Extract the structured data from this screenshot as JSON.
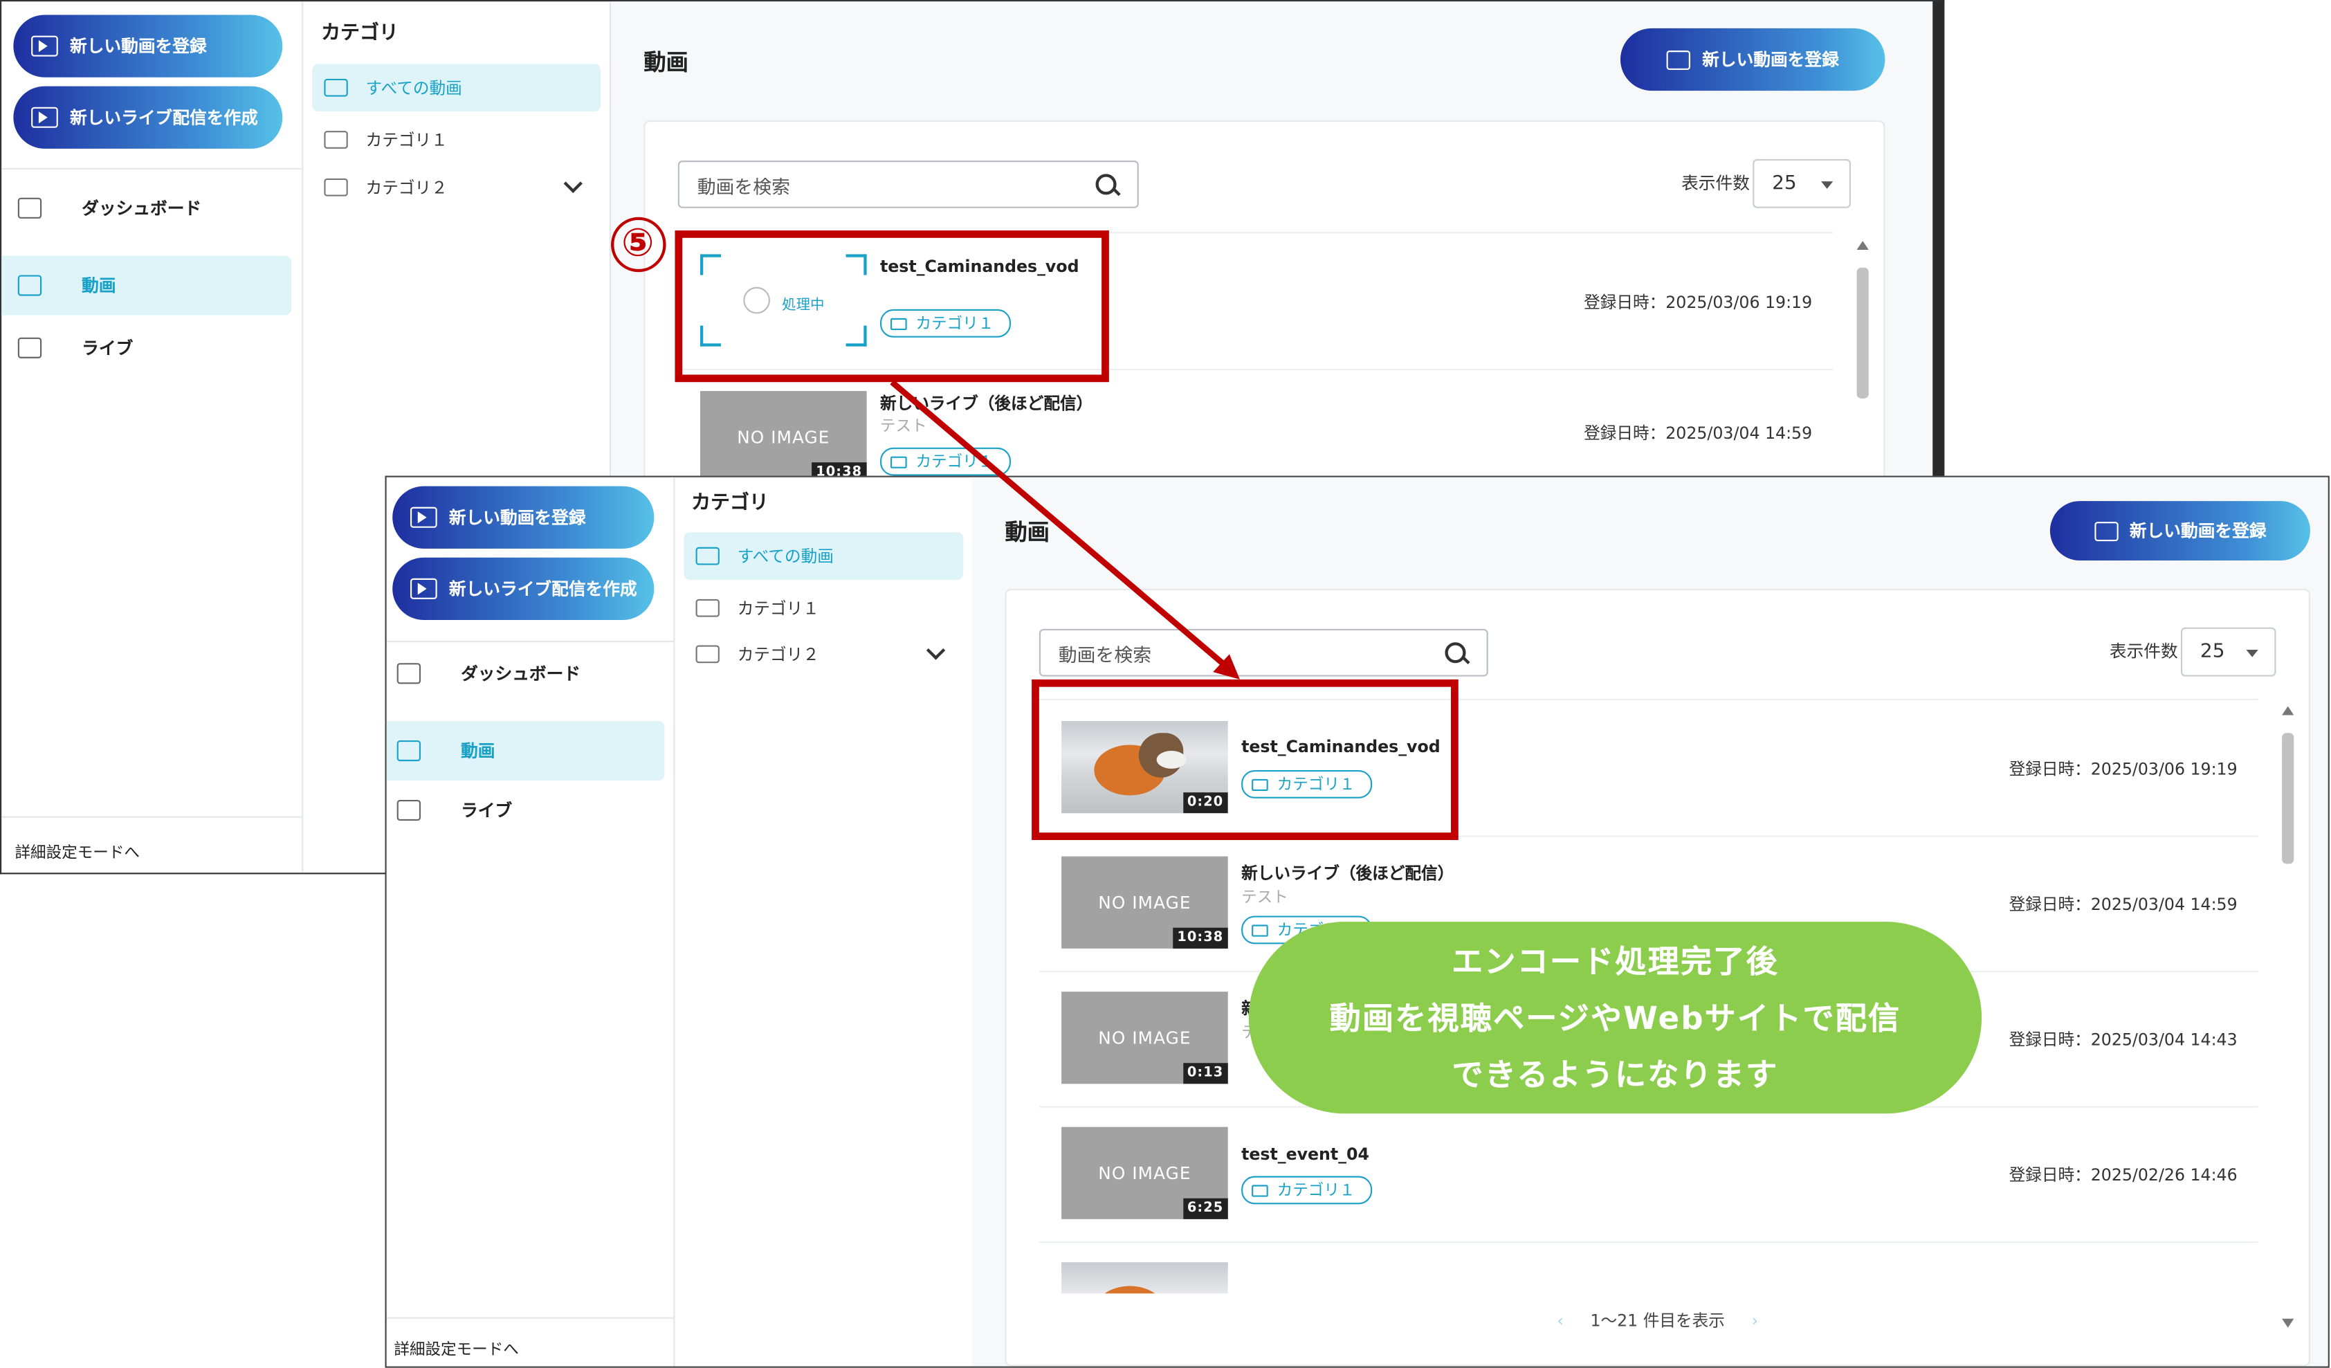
{
  "annotation": {
    "step_number": "⑤",
    "callout_line1": "エンコード処理完了後",
    "callout_line2": "動画を視聴ページやWebサイトで配信",
    "callout_line3": "できるようになります",
    "highlight_color": "#c00000",
    "callout_color": "#8ccd4e"
  },
  "nav": {
    "new_video": "新しい動画を登録",
    "new_live": "新しいライブ配信を作成",
    "dashboard": "ダッシュボード",
    "videos": "動画",
    "live": "ライブ",
    "advanced": "詳細設定モードへ"
  },
  "categories": {
    "title": "カテゴリ",
    "all": "すべての動画",
    "cat1": "カテゴリ１",
    "cat2": "カテゴリ２"
  },
  "main": {
    "title": "動画",
    "register_button": "新しい動画を登録",
    "search_placeholder": "動画を検索",
    "per_page_label": "表示件数",
    "per_page_value": "25",
    "pagination": "1～21 件目を表示"
  },
  "back_rows": [
    {
      "name": "test_Caminandes_vod",
      "status": "処理中",
      "tag": "カテゴリ１",
      "date": "登録日時：2025/03/06 19:19"
    },
    {
      "name": "新しいライブ（後ほど配信）",
      "sub": "テスト",
      "thumb": "NO IMAGE",
      "duration": "10:38",
      "tag": "カテゴリ１",
      "date": "登録日時：2025/03/04 14:59"
    }
  ],
  "front_rows": [
    {
      "name": "test_Caminandes_vod",
      "duration": "0:20",
      "tag": "カテゴリ１",
      "date": "登録日時：2025/03/06 19:19"
    },
    {
      "name": "新しいライブ（後ほど配信）",
      "sub": "テスト",
      "thumb": "NO IMAGE",
      "duration": "10:38",
      "tag": "カテゴリ１",
      "date": "登録日時：2025/03/04 14:59"
    },
    {
      "name": "新",
      "sub": "テ",
      "thumb": "NO IMAGE",
      "duration": "0:13",
      "date": "登録日時：2025/03/04 14:43"
    },
    {
      "name": "test_event_04",
      "thumb": "NO IMAGE",
      "duration": "6:25",
      "tag": "カテゴリ１",
      "date": "登録日時：2025/02/26 14:46"
    }
  ]
}
